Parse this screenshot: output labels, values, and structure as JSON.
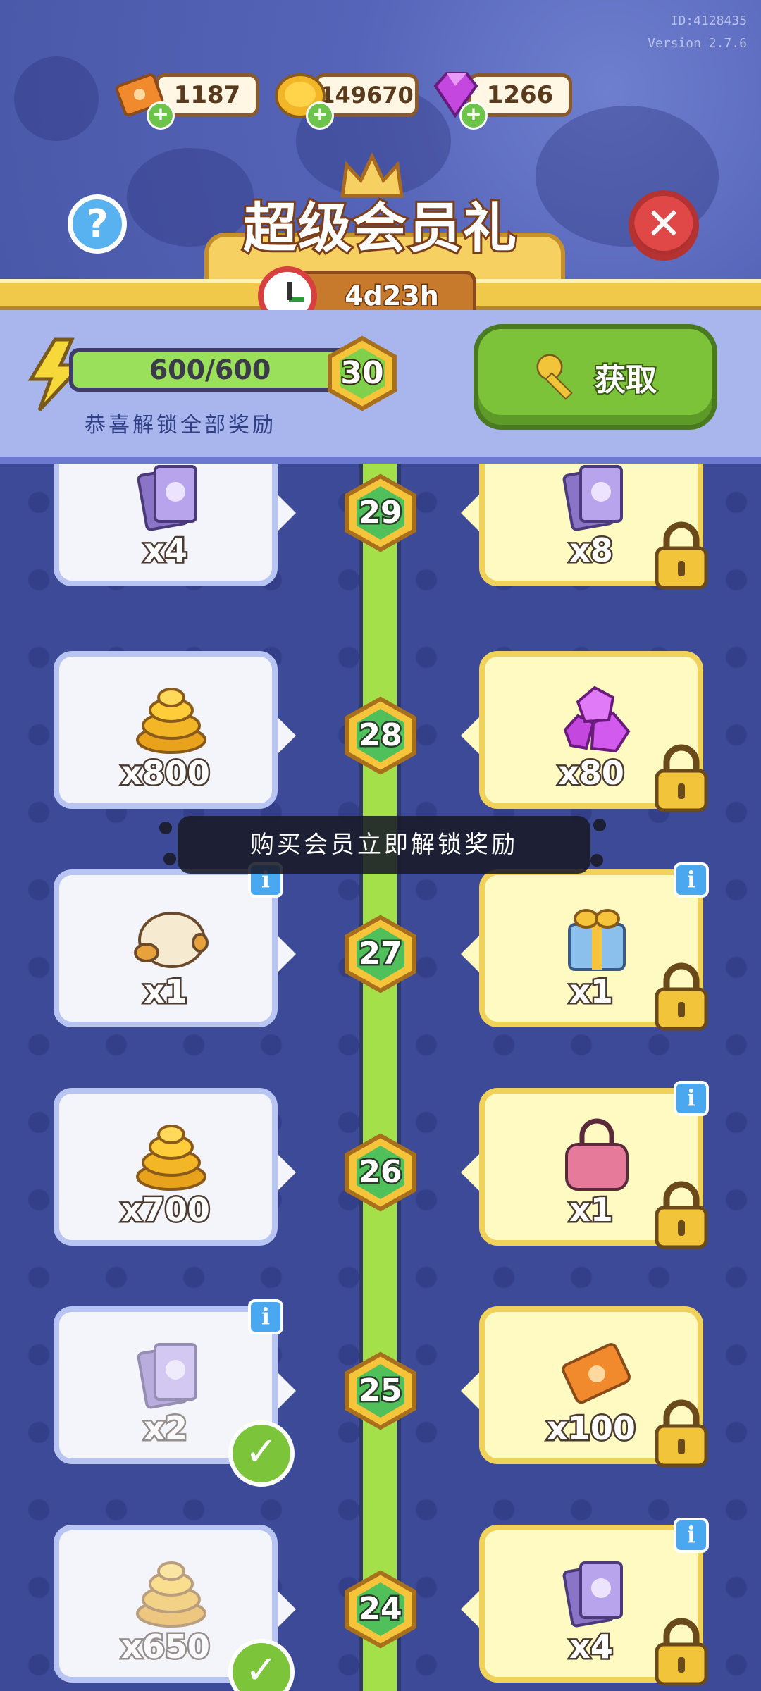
{
  "version": {
    "id": "ID:4128435",
    "version": "Version 2.7.6"
  },
  "resources": [
    {
      "name": "ticket",
      "value": "1187",
      "color": "#f08a2c"
    },
    {
      "name": "coin",
      "value": "149670",
      "color": "#f2b627"
    },
    {
      "name": "gem",
      "value": "1266",
      "color": "#c447e0"
    }
  ],
  "header": {
    "title": "超级会员礼",
    "timer": "4d23h",
    "help_icon": "question-icon",
    "close_icon": "close-icon"
  },
  "progress": {
    "value": "600/600",
    "fraction": 1.0,
    "level": "30",
    "status": "恭喜解锁全部奖励",
    "get_label": "获取"
  },
  "toast": "购买会员立即解锁奖励",
  "levels": [
    {
      "level": "29",
      "free": {
        "item": "card",
        "qty": "x4",
        "claimed": false
      },
      "premium": {
        "item": "card",
        "qty": "x8",
        "locked": true
      }
    },
    {
      "level": "28",
      "free": {
        "item": "coins",
        "qty": "x800",
        "claimed": false
      },
      "premium": {
        "item": "gems",
        "qty": "x80",
        "locked": true
      }
    },
    {
      "level": "27",
      "free": {
        "item": "bun",
        "qty": "x1",
        "claimed": false,
        "info": true
      },
      "premium": {
        "item": "gift-box",
        "qty": "x1",
        "locked": true,
        "info": true
      }
    },
    {
      "level": "26",
      "free": {
        "item": "coins",
        "qty": "x700",
        "claimed": false
      },
      "premium": {
        "item": "bag",
        "qty": "x1",
        "locked": true,
        "info": true
      }
    },
    {
      "level": "25",
      "free": {
        "item": "card",
        "qty": "x2",
        "claimed": true,
        "info": true
      },
      "premium": {
        "item": "ticket",
        "qty": "x100",
        "locked": true
      }
    },
    {
      "level": "24",
      "free": {
        "item": "coins",
        "qty": "x650",
        "claimed": true
      },
      "premium": {
        "item": "card",
        "qty": "x4",
        "locked": true,
        "info": true
      }
    }
  ]
}
